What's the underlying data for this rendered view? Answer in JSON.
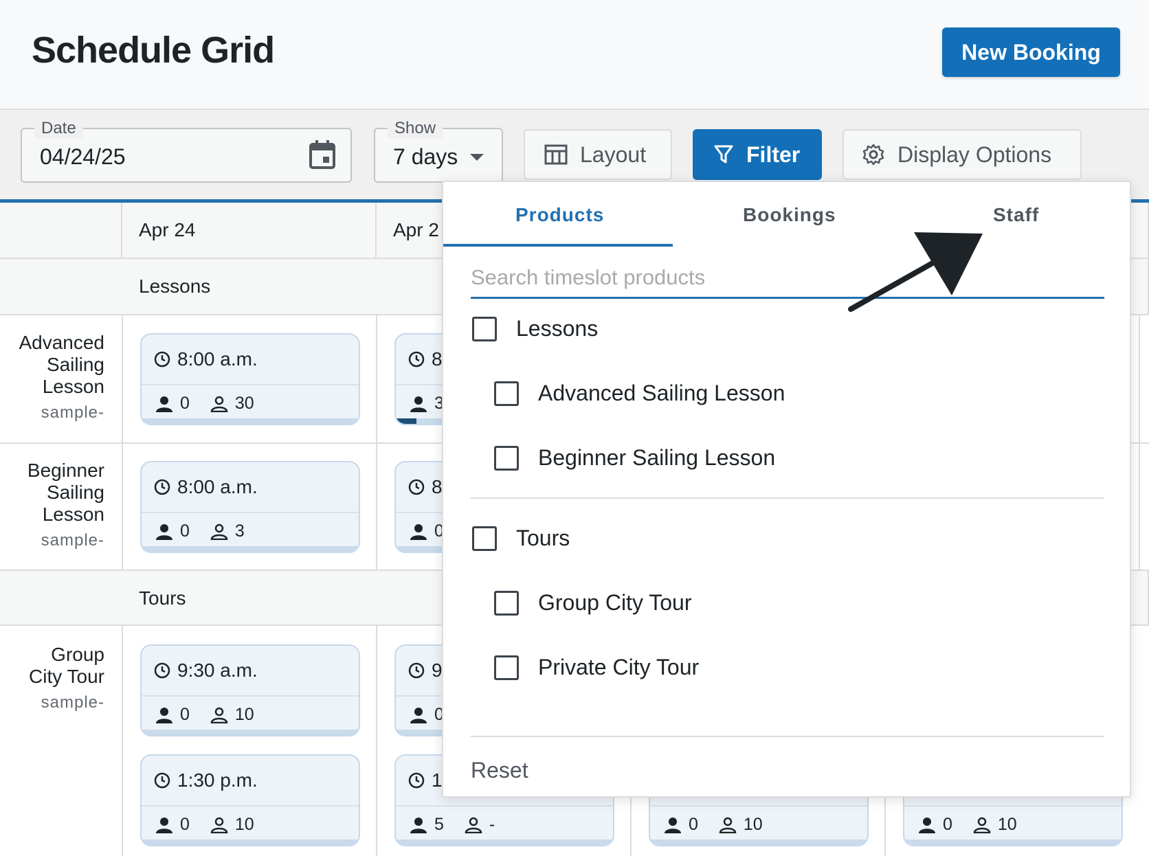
{
  "header": {
    "title": "Schedule Grid",
    "new_booking_label": "New Booking"
  },
  "toolbar": {
    "date_label": "Date",
    "date_value": "04/24/25",
    "show_label": "Show",
    "show_value": "7 days",
    "layout_label": "Layout",
    "filter_label": "Filter",
    "display_options_label": "Display Options"
  },
  "grid": {
    "columns": [
      "Apr 24",
      "Apr 2"
    ],
    "groups": [
      "Lessons",
      "Tours"
    ],
    "rows": [
      {
        "name_lines": [
          "Advanced",
          "Sailing",
          "Lesson"
        ],
        "sub": "sample-"
      },
      {
        "name_lines": [
          "Beginner",
          "Sailing",
          "Lesson"
        ],
        "sub": "sample-"
      },
      {
        "name_lines": [
          "Group",
          "City Tour"
        ],
        "sub": "sample-"
      }
    ],
    "slots": {
      "adv_col1": {
        "time": "8:00 a.m.",
        "booked": "0",
        "capacity": "30"
      },
      "adv_col2": {
        "time": "8",
        "booked": "3"
      },
      "beg_col1": {
        "time": "8:00 a.m.",
        "booked": "0",
        "capacity": "3"
      },
      "beg_col2": {
        "time": "8",
        "booked": "0"
      },
      "tour1_col1": {
        "time": "9:30 a.m.",
        "booked": "0",
        "capacity": "10"
      },
      "tour1_col2": {
        "time": "9",
        "booked": "0"
      },
      "tour2_col1": {
        "time": "1:30 p.m.",
        "booked": "0",
        "capacity": "10"
      },
      "tour2_col2": {
        "time": "1",
        "booked": "5",
        "capacity": "-"
      },
      "tour2_col3": {
        "booked": "0",
        "capacity": "10"
      },
      "tour2_col4": {
        "booked": "0",
        "capacity": "10"
      }
    }
  },
  "filter_panel": {
    "tabs": [
      "Products",
      "Bookings",
      "Staff"
    ],
    "search_placeholder": "Search timeslot products",
    "search_value": "",
    "groups": [
      {
        "label": "Lessons",
        "items": [
          "Advanced Sailing Lesson",
          "Beginner Sailing Lesson"
        ]
      },
      {
        "label": "Tours",
        "items": [
          "Group City Tour",
          "Private City Tour"
        ]
      }
    ],
    "reset_label": "Reset"
  },
  "colors": {
    "primary": "#1370b8",
    "accent_blue": "#2271b1",
    "slot_bg": "#eef3f9"
  }
}
